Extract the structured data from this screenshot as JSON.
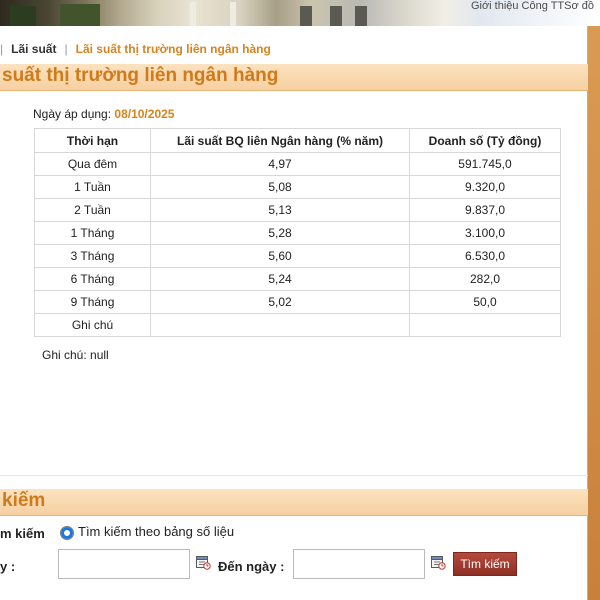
{
  "header": {
    "links": "Giới thiệu Công TTSơ đồ"
  },
  "breadcrumb": {
    "item1": "Lãi suất",
    "item2": "Lãi suất thị trường liên ngân hàng"
  },
  "section1": {
    "title": "suất thị trường liên ngân hàng"
  },
  "applied": {
    "label": "Ngày áp dụng:",
    "date": "08/10/2025"
  },
  "table": {
    "headers": [
      "Thời hạn",
      "Lãi suất BQ liên Ngân hàng (% năm)",
      "Doanh số (Tỷ đồng)"
    ],
    "rows": [
      [
        "Qua đêm",
        "4,97",
        "591.745,0"
      ],
      [
        "1 Tuần",
        "5,08",
        "9.320,0"
      ],
      [
        "2 Tuần",
        "5,13",
        "9.837,0"
      ],
      [
        "1 Tháng",
        "5,28",
        "3.100,0"
      ],
      [
        "3 Tháng",
        "5,60",
        "6.530,0"
      ],
      [
        "6 Tháng",
        "5,24",
        "282,0"
      ],
      [
        "9 Tháng",
        "5,02",
        "50,0"
      ],
      [
        "Ghi chú",
        "",
        ""
      ]
    ]
  },
  "note": "Ghi chú: null",
  "section2": {
    "title": "kiếm"
  },
  "search": {
    "label": "m kiếm",
    "radio_label": "Tìm kiếm theo bảng số liệu",
    "from_label": "y :",
    "to_label": "Đến ngày :",
    "button_label": "Tìm kiếm",
    "from_value": "",
    "to_value": ""
  },
  "icons": {
    "calendar": "calendar-icon",
    "radio": "radio-selected"
  },
  "colors": {
    "accent": "#d8831e",
    "title_bar": "#f8d9b0",
    "button": "#a33c30"
  }
}
